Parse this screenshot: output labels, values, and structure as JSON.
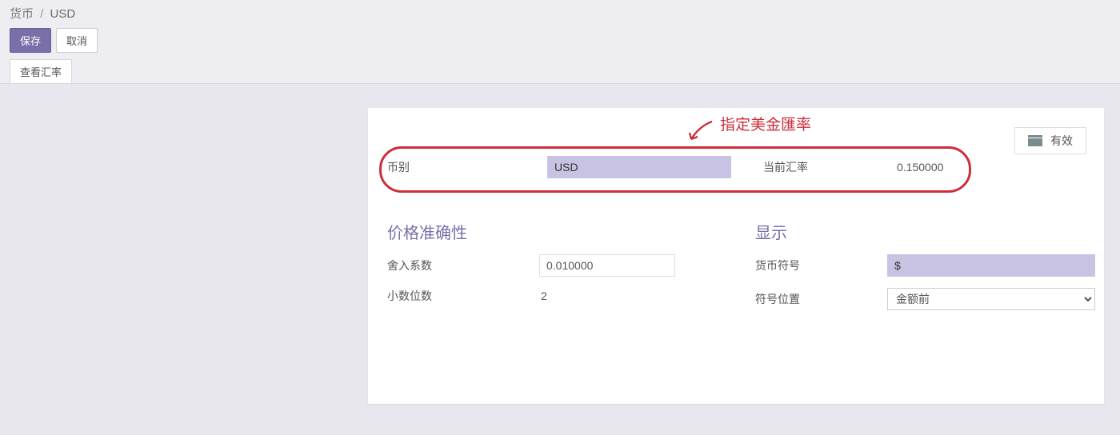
{
  "breadcrumb": {
    "main": "货币",
    "sep": "/",
    "current": "USD"
  },
  "actions": {
    "save": "保存",
    "discard": "取消"
  },
  "tabs": {
    "rates": "查看汇率"
  },
  "annotation": {
    "text": "指定美金匯率"
  },
  "status": {
    "label": "有效"
  },
  "form": {
    "currency_label": "币别",
    "currency_value": "USD",
    "rate_label": "当前汇率",
    "rate_value": "0.150000"
  },
  "accuracy": {
    "title": "价格准确性",
    "rounding_label": "舍入系数",
    "rounding_value": "0.010000",
    "decimal_label": "小数位数",
    "decimal_value": "2"
  },
  "display": {
    "title": "显示",
    "symbol_label": "货币符号",
    "symbol_value": "$",
    "position_label": "符号位置",
    "position_value": "金额前"
  }
}
